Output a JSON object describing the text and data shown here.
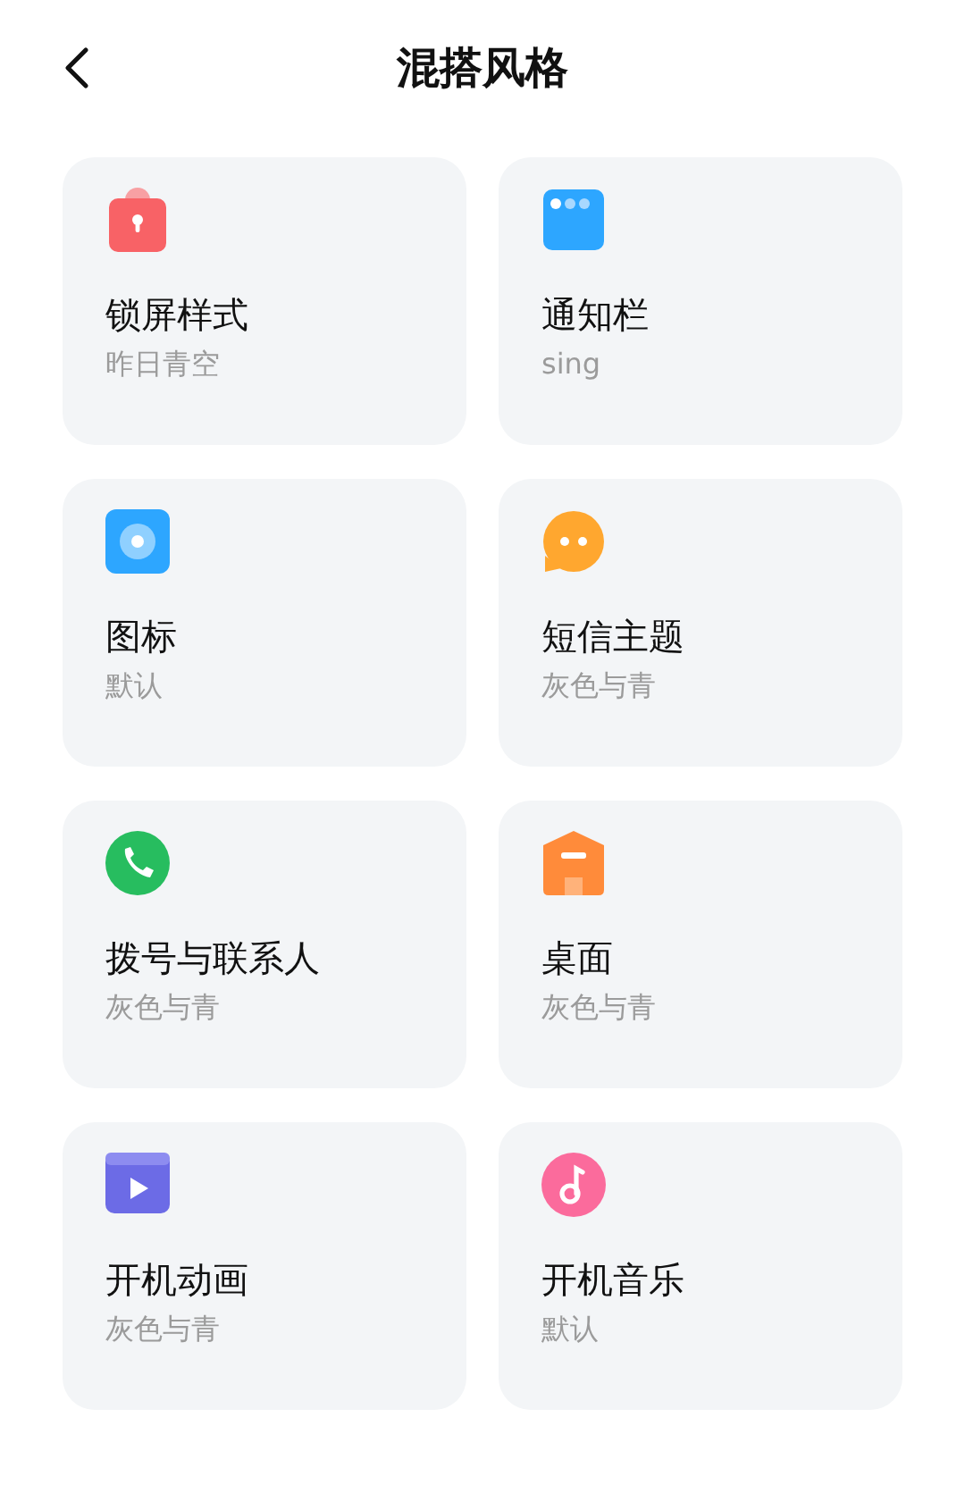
{
  "header": {
    "title": "混搭风格"
  },
  "items": [
    {
      "title": "锁屏样式",
      "subtitle": "昨日青空"
    },
    {
      "title": "通知栏",
      "subtitle": "sing"
    },
    {
      "title": "图标",
      "subtitle": "默认"
    },
    {
      "title": "短信主题",
      "subtitle": "灰色与青"
    },
    {
      "title": "拨号与联系人",
      "subtitle": "灰色与青"
    },
    {
      "title": "桌面",
      "subtitle": "灰色与青"
    },
    {
      "title": "开机动画",
      "subtitle": "灰色与青"
    },
    {
      "title": "开机音乐",
      "subtitle": "默认"
    }
  ]
}
